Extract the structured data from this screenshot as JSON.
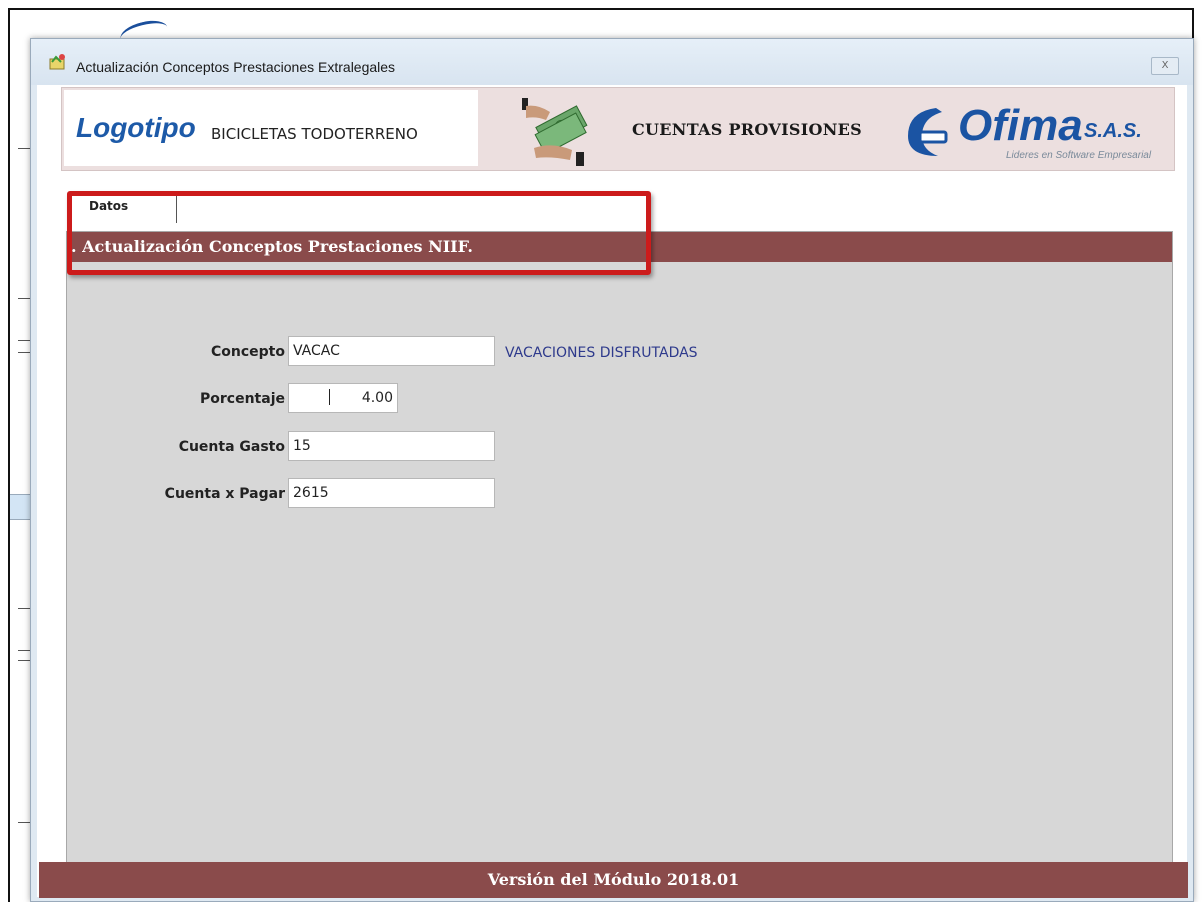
{
  "window": {
    "title": "Actualización Conceptos Prestaciones Extralegales",
    "close_label": "X"
  },
  "banner": {
    "logo_text": "Logotipo",
    "company": "BICICLETAS TODOTERRENO",
    "module": "CUENTAS PROVISIONES",
    "brand_name": "Ofima",
    "brand_suffix": "S.A.S.",
    "brand_slogan": "Lideres en Software Empresarial"
  },
  "tabs": [
    {
      "label": "Datos",
      "active": true
    }
  ],
  "section": {
    "title": ". Actualización Conceptos Prestaciones NIIF."
  },
  "form": {
    "concepto": {
      "label": "Concepto",
      "value": "VACAC",
      "description": "VACACIONES DISFRUTADAS"
    },
    "porcentaje": {
      "label": "Porcentaje",
      "value": "4.00"
    },
    "cuenta_gasto": {
      "label": "Cuenta Gasto",
      "value": "15"
    },
    "cuenta_pagar": {
      "label": "Cuenta x Pagar",
      "value": "2615"
    }
  },
  "footer": {
    "version": "Versión del Módulo 2018.01"
  },
  "colors": {
    "header_bar": "#8a4b4b",
    "panel": "#d7d7d7",
    "highlight": "#cc1b1b",
    "brand_blue": "#1b54a3"
  }
}
